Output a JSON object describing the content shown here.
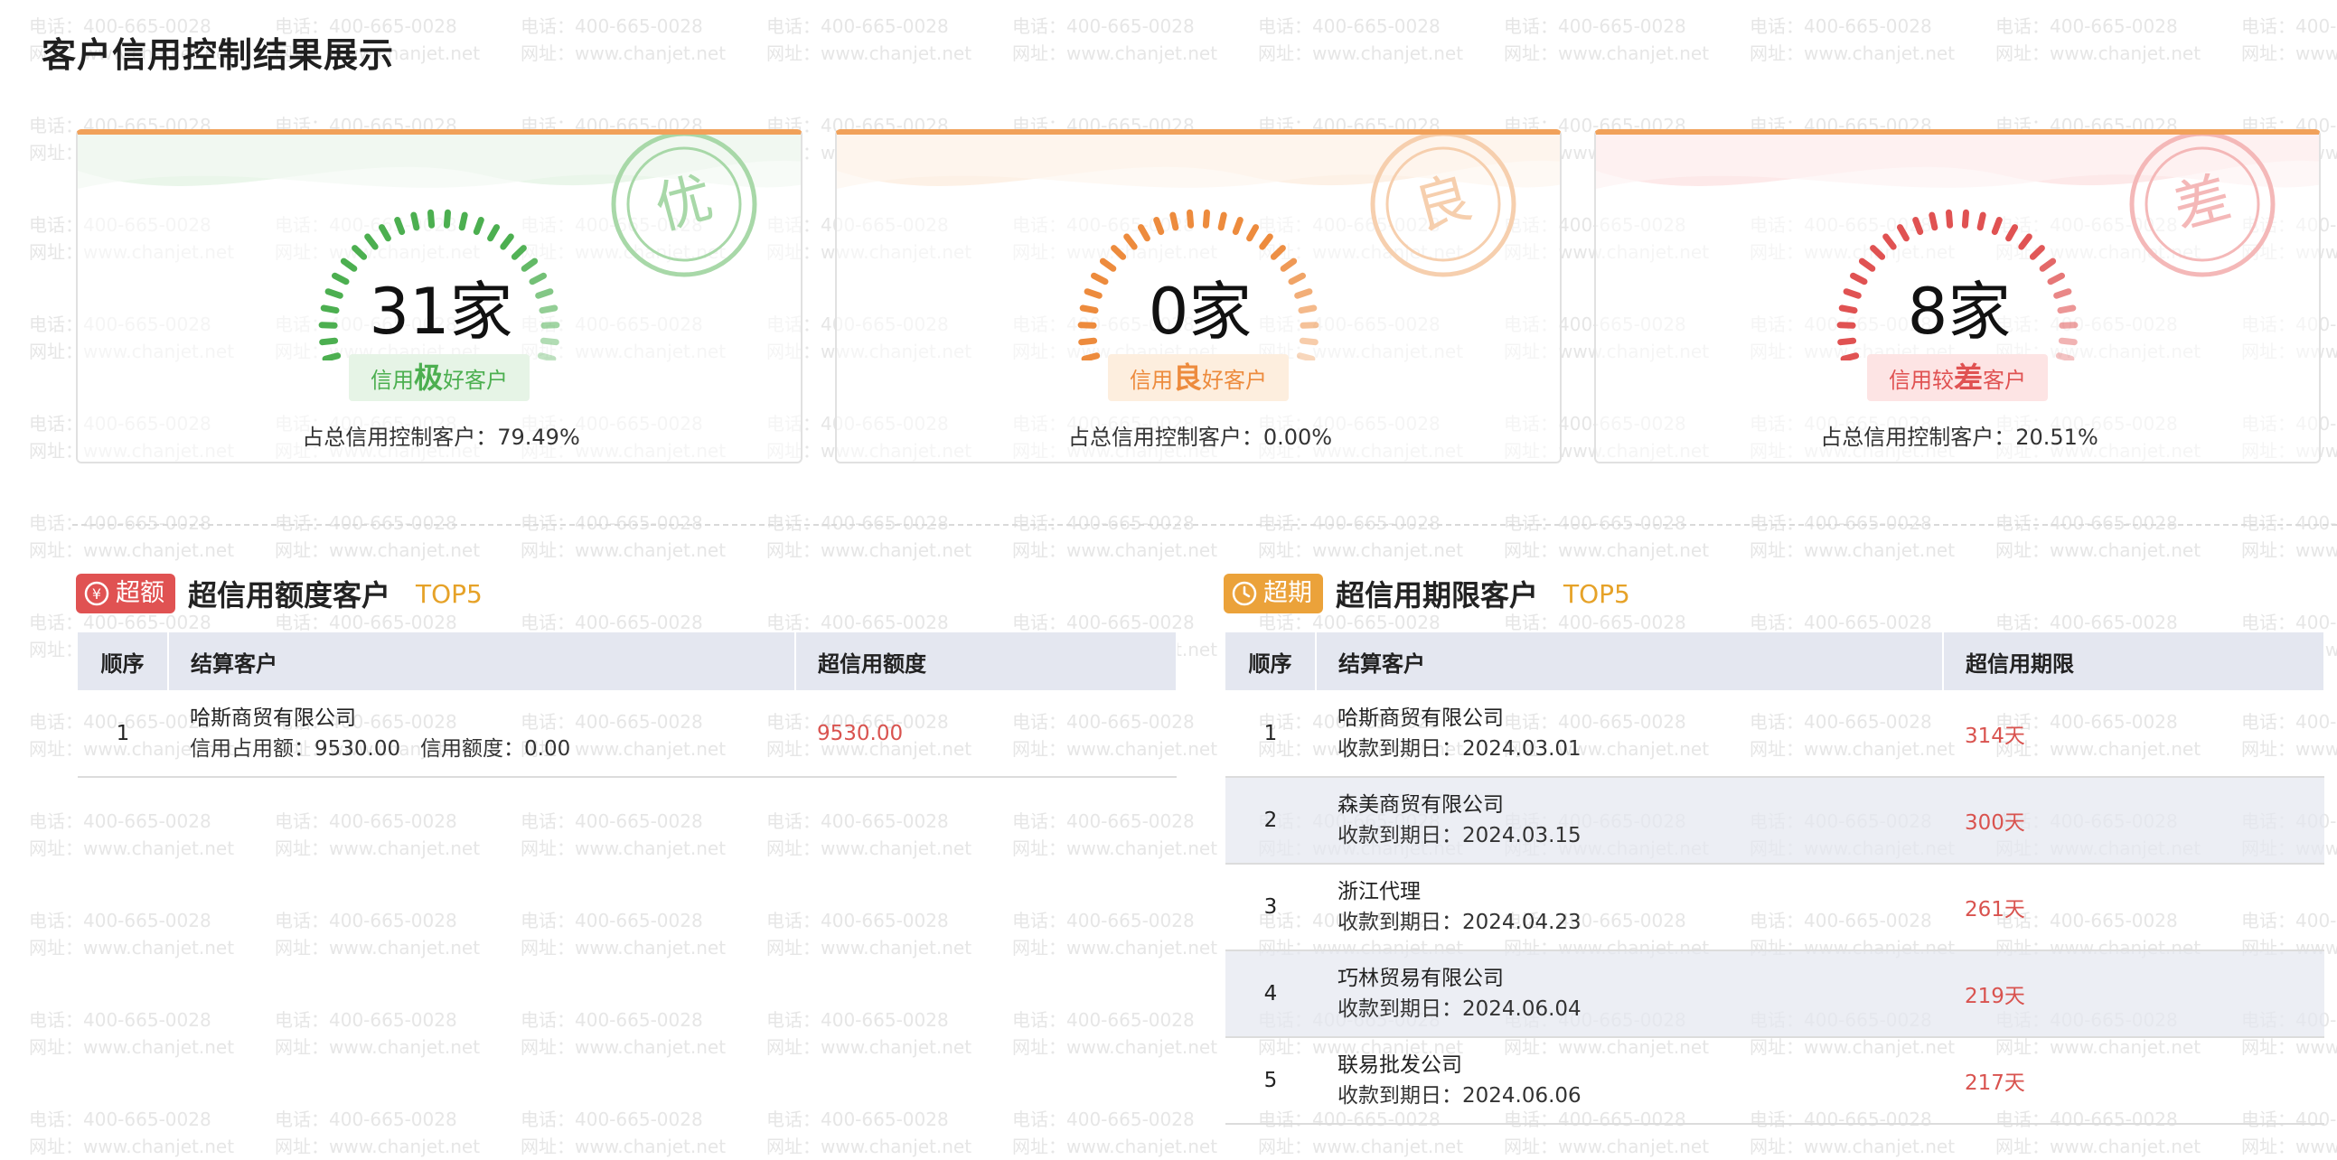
{
  "page_title": "客户信用控制结果展示",
  "watermark": {
    "phone": "电话：400-665-0028",
    "site": "网址：www.chanjet.net"
  },
  "colors": {
    "excellent": "#4caf50",
    "good": "#ed8b3d",
    "poor": "#e05252",
    "tag_overlimit": "#e05252",
    "tag_overdue": "#eba23a"
  },
  "cards": [
    {
      "stamp": "优",
      "count": "31家",
      "badge_pre": "信用",
      "badge_hl": "极",
      "badge_post": "好客户",
      "ratio": "占总信用控制客户：79.49%"
    },
    {
      "stamp": "良",
      "count": "0家",
      "badge_pre": "信用",
      "badge_hl": "良",
      "badge_post": "好客户",
      "ratio": "占总信用控制客户：0.00%"
    },
    {
      "stamp": "差",
      "count": "8家",
      "badge_pre": "信用较",
      "badge_hl": "差",
      "badge_post": "客户",
      "ratio": "占总信用控制客户：20.51%"
    }
  ],
  "over_limit": {
    "tag": "超额",
    "title": "超信用额度客户",
    "top": "TOP5",
    "columns": [
      "顺序",
      "结算客户",
      "超信用额度"
    ],
    "rows": [
      {
        "seq": "1",
        "name": "哈斯商贸有限公司",
        "detail": "信用占用额：9530.00   信用额度：0.00",
        "value": "9530.00"
      }
    ]
  },
  "over_due": {
    "tag": "超期",
    "title": "超信用期限客户",
    "top": "TOP5",
    "columns": [
      "顺序",
      "结算客户",
      "超信用期限"
    ],
    "rows": [
      {
        "seq": "1",
        "name": "哈斯商贸有限公司",
        "detail": "收款到期日：2024.03.01",
        "value": "314天"
      },
      {
        "seq": "2",
        "name": "森美商贸有限公司",
        "detail": "收款到期日：2024.03.15",
        "value": "300天"
      },
      {
        "seq": "3",
        "name": "浙江代理",
        "detail": "收款到期日：2024.04.23",
        "value": "261天"
      },
      {
        "seq": "4",
        "name": "巧林贸易有限公司",
        "detail": "收款到期日：2024.06.04",
        "value": "219天"
      },
      {
        "seq": "5",
        "name": "联易批发公司",
        "detail": "收款到期日：2024.06.06",
        "value": "217天"
      }
    ]
  }
}
